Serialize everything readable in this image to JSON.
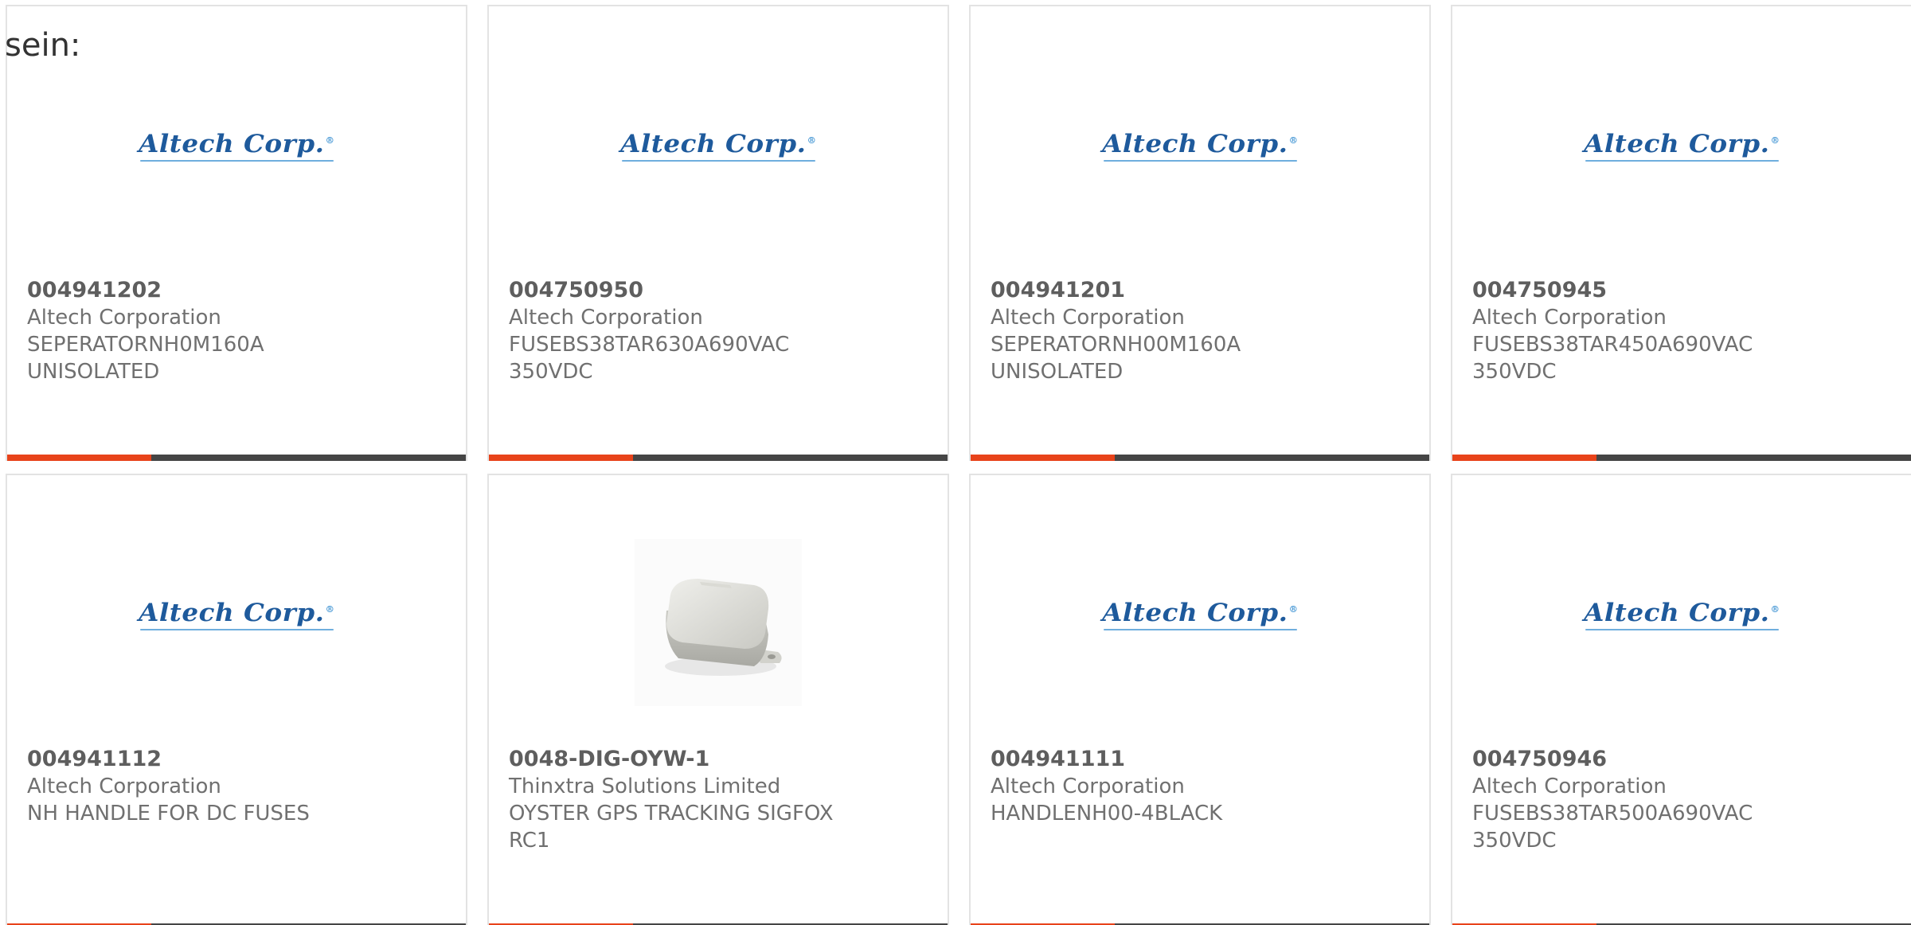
{
  "intro_text": "sein:",
  "colors": {
    "accent_bar": "#e8431a",
    "dark_bar": "#454545",
    "logo_blue": "#1e5a9c"
  },
  "products": [
    {
      "part_number": "004941202",
      "manufacturer": "Altech Corporation",
      "description_line1": "SEPERATORNH0M160A",
      "description_line2": "UNISOLATED",
      "image": "altech-logo",
      "logo_text": "Altech Corp."
    },
    {
      "part_number": "004750950",
      "manufacturer": "Altech Corporation",
      "description_line1": "FUSEBS38TAR630A690VAC",
      "description_line2": "350VDC",
      "image": "altech-logo",
      "logo_text": "Altech Corp."
    },
    {
      "part_number": "004941201",
      "manufacturer": "Altech Corporation",
      "description_line1": "SEPERATORNH00M160A",
      "description_line2": "UNISOLATED",
      "image": "altech-logo",
      "logo_text": "Altech Corp."
    },
    {
      "part_number": "004750945",
      "manufacturer": "Altech Corporation",
      "description_line1": "FUSEBS38TAR450A690VAC",
      "description_line2": "350VDC",
      "image": "altech-logo",
      "logo_text": "Altech Corp."
    },
    {
      "part_number": "004941112",
      "manufacturer": "Altech Corporation",
      "description_line1": "NH HANDLE FOR DC FUSES",
      "description_line2": "",
      "image": "altech-logo",
      "logo_text": "Altech Corp."
    },
    {
      "part_number": "0048-DIG-OYW-1",
      "manufacturer": "Thinxtra Solutions Limited",
      "description_line1": "OYSTER GPS TRACKING SIGFOX",
      "description_line2": "RC1",
      "image": "gps-tracker-device-photo",
      "logo_text": ""
    },
    {
      "part_number": "004941111",
      "manufacturer": "Altech Corporation",
      "description_line1": "HANDLENH00-4BLACK",
      "description_line2": "",
      "image": "altech-logo",
      "logo_text": "Altech Corp."
    },
    {
      "part_number": "004750946",
      "manufacturer": "Altech Corporation",
      "description_line1": "FUSEBS38TAR500A690VAC",
      "description_line2": "350VDC",
      "image": "altech-logo",
      "logo_text": "Altech Corp."
    }
  ]
}
